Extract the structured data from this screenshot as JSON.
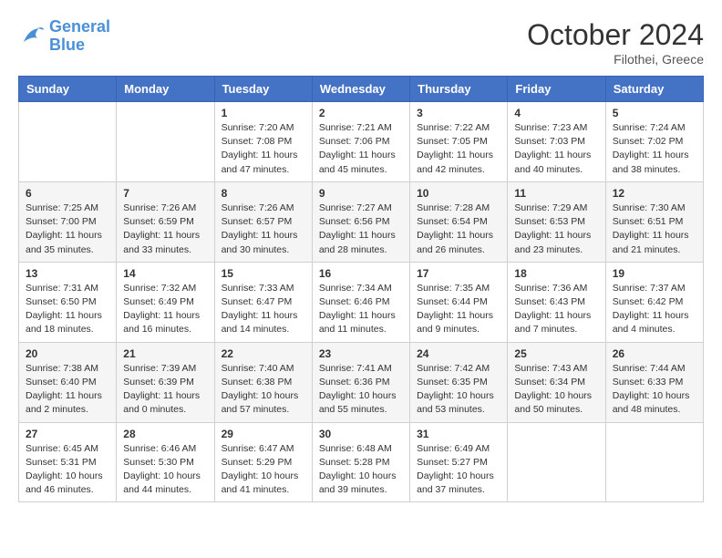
{
  "header": {
    "logo_line1": "General",
    "logo_line2": "Blue",
    "month": "October 2024",
    "location": "Filothei, Greece"
  },
  "weekdays": [
    "Sunday",
    "Monday",
    "Tuesday",
    "Wednesday",
    "Thursday",
    "Friday",
    "Saturday"
  ],
  "weeks": [
    [
      {
        "day": "",
        "info": ""
      },
      {
        "day": "",
        "info": ""
      },
      {
        "day": "1",
        "info": "Sunrise: 7:20 AM\nSunset: 7:08 PM\nDaylight: 11 hours and 47 minutes."
      },
      {
        "day": "2",
        "info": "Sunrise: 7:21 AM\nSunset: 7:06 PM\nDaylight: 11 hours and 45 minutes."
      },
      {
        "day": "3",
        "info": "Sunrise: 7:22 AM\nSunset: 7:05 PM\nDaylight: 11 hours and 42 minutes."
      },
      {
        "day": "4",
        "info": "Sunrise: 7:23 AM\nSunset: 7:03 PM\nDaylight: 11 hours and 40 minutes."
      },
      {
        "day": "5",
        "info": "Sunrise: 7:24 AM\nSunset: 7:02 PM\nDaylight: 11 hours and 38 minutes."
      }
    ],
    [
      {
        "day": "6",
        "info": "Sunrise: 7:25 AM\nSunset: 7:00 PM\nDaylight: 11 hours and 35 minutes."
      },
      {
        "day": "7",
        "info": "Sunrise: 7:26 AM\nSunset: 6:59 PM\nDaylight: 11 hours and 33 minutes."
      },
      {
        "day": "8",
        "info": "Sunrise: 7:26 AM\nSunset: 6:57 PM\nDaylight: 11 hours and 30 minutes."
      },
      {
        "day": "9",
        "info": "Sunrise: 7:27 AM\nSunset: 6:56 PM\nDaylight: 11 hours and 28 minutes."
      },
      {
        "day": "10",
        "info": "Sunrise: 7:28 AM\nSunset: 6:54 PM\nDaylight: 11 hours and 26 minutes."
      },
      {
        "day": "11",
        "info": "Sunrise: 7:29 AM\nSunset: 6:53 PM\nDaylight: 11 hours and 23 minutes."
      },
      {
        "day": "12",
        "info": "Sunrise: 7:30 AM\nSunset: 6:51 PM\nDaylight: 11 hours and 21 minutes."
      }
    ],
    [
      {
        "day": "13",
        "info": "Sunrise: 7:31 AM\nSunset: 6:50 PM\nDaylight: 11 hours and 18 minutes."
      },
      {
        "day": "14",
        "info": "Sunrise: 7:32 AM\nSunset: 6:49 PM\nDaylight: 11 hours and 16 minutes."
      },
      {
        "day": "15",
        "info": "Sunrise: 7:33 AM\nSunset: 6:47 PM\nDaylight: 11 hours and 14 minutes."
      },
      {
        "day": "16",
        "info": "Sunrise: 7:34 AM\nSunset: 6:46 PM\nDaylight: 11 hours and 11 minutes."
      },
      {
        "day": "17",
        "info": "Sunrise: 7:35 AM\nSunset: 6:44 PM\nDaylight: 11 hours and 9 minutes."
      },
      {
        "day": "18",
        "info": "Sunrise: 7:36 AM\nSunset: 6:43 PM\nDaylight: 11 hours and 7 minutes."
      },
      {
        "day": "19",
        "info": "Sunrise: 7:37 AM\nSunset: 6:42 PM\nDaylight: 11 hours and 4 minutes."
      }
    ],
    [
      {
        "day": "20",
        "info": "Sunrise: 7:38 AM\nSunset: 6:40 PM\nDaylight: 11 hours and 2 minutes."
      },
      {
        "day": "21",
        "info": "Sunrise: 7:39 AM\nSunset: 6:39 PM\nDaylight: 11 hours and 0 minutes."
      },
      {
        "day": "22",
        "info": "Sunrise: 7:40 AM\nSunset: 6:38 PM\nDaylight: 10 hours and 57 minutes."
      },
      {
        "day": "23",
        "info": "Sunrise: 7:41 AM\nSunset: 6:36 PM\nDaylight: 10 hours and 55 minutes."
      },
      {
        "day": "24",
        "info": "Sunrise: 7:42 AM\nSunset: 6:35 PM\nDaylight: 10 hours and 53 minutes."
      },
      {
        "day": "25",
        "info": "Sunrise: 7:43 AM\nSunset: 6:34 PM\nDaylight: 10 hours and 50 minutes."
      },
      {
        "day": "26",
        "info": "Sunrise: 7:44 AM\nSunset: 6:33 PM\nDaylight: 10 hours and 48 minutes."
      }
    ],
    [
      {
        "day": "27",
        "info": "Sunrise: 6:45 AM\nSunset: 5:31 PM\nDaylight: 10 hours and 46 minutes."
      },
      {
        "day": "28",
        "info": "Sunrise: 6:46 AM\nSunset: 5:30 PM\nDaylight: 10 hours and 44 minutes."
      },
      {
        "day": "29",
        "info": "Sunrise: 6:47 AM\nSunset: 5:29 PM\nDaylight: 10 hours and 41 minutes."
      },
      {
        "day": "30",
        "info": "Sunrise: 6:48 AM\nSunset: 5:28 PM\nDaylight: 10 hours and 39 minutes."
      },
      {
        "day": "31",
        "info": "Sunrise: 6:49 AM\nSunset: 5:27 PM\nDaylight: 10 hours and 37 minutes."
      },
      {
        "day": "",
        "info": ""
      },
      {
        "day": "",
        "info": ""
      }
    ]
  ]
}
